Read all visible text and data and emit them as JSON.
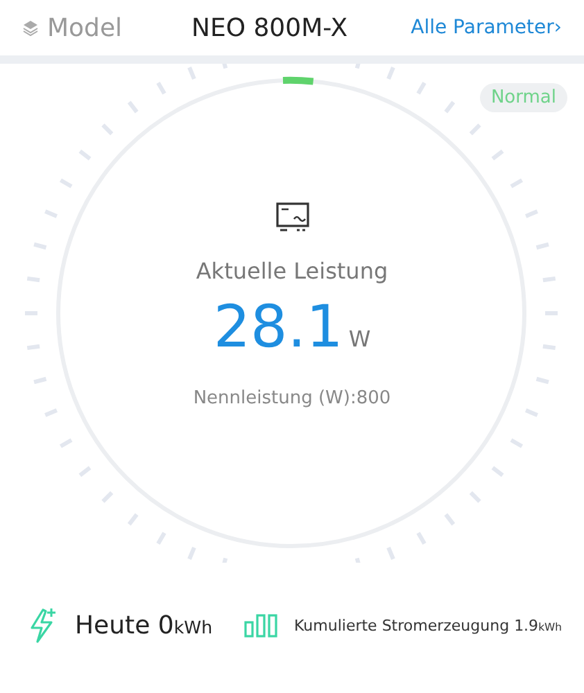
{
  "header": {
    "label": "Model",
    "model": "NEO 800M-X",
    "link": "Alle Parameter›"
  },
  "status": "Normal",
  "gauge": {
    "title": "Aktuelle Leistung",
    "value": "28.1",
    "unit": "W",
    "rated": "Nennleistung (W):800"
  },
  "today": {
    "label": "Heute",
    "value": "0",
    "unit": "kWh"
  },
  "total": {
    "label": "Kumulierte Stromerzeugung",
    "value": "1.9",
    "unit": "kWh"
  }
}
